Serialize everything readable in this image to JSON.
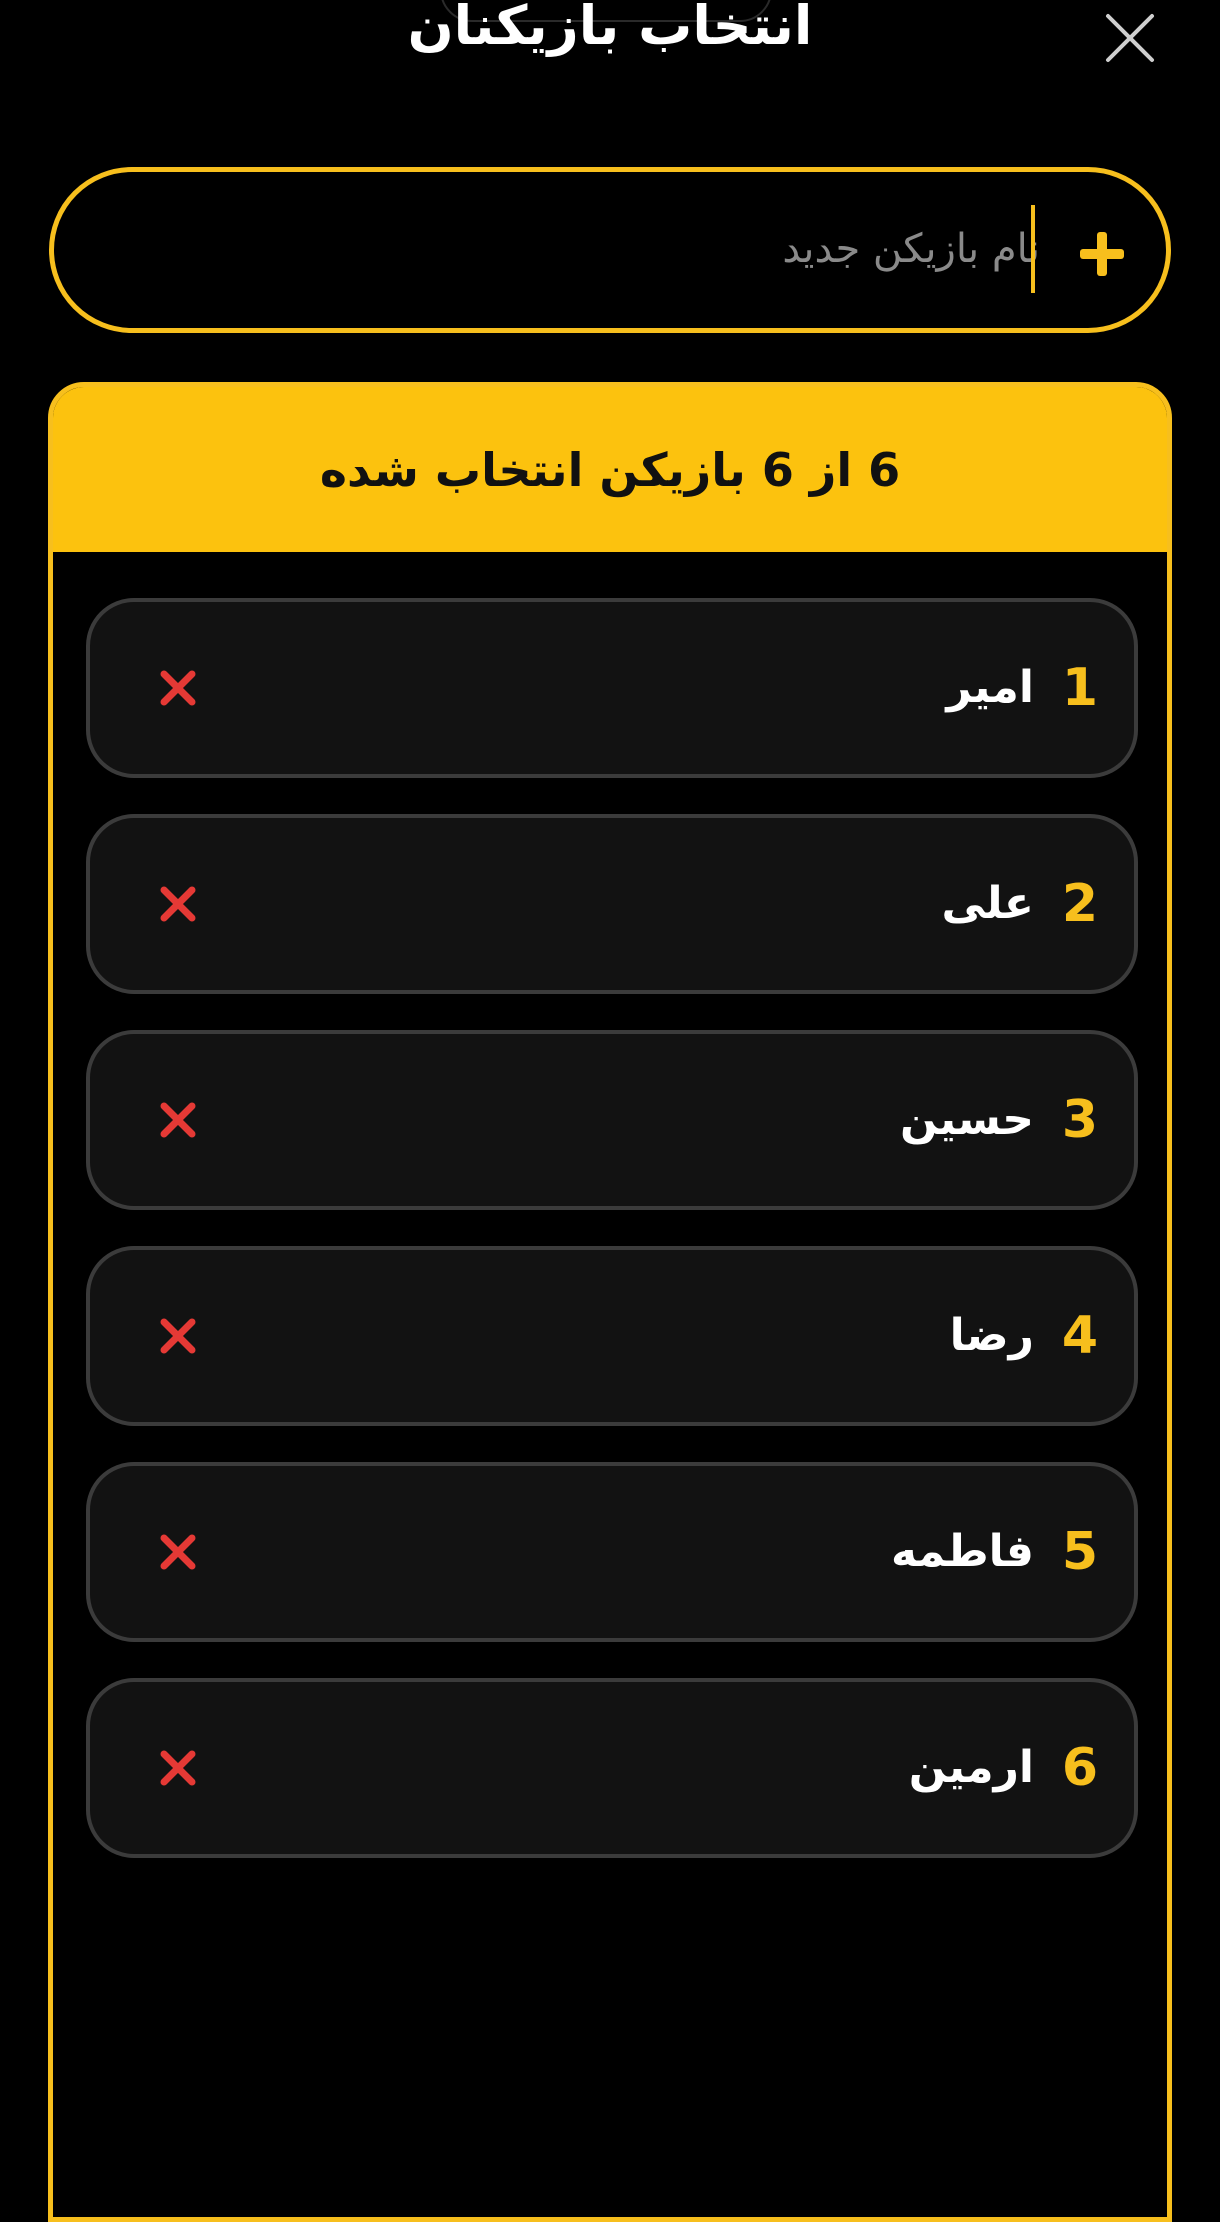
{
  "header": {
    "title": "انتخاب بازیکنان"
  },
  "add_player": {
    "placeholder": "نام بازیکن جدید",
    "value": ""
  },
  "panel": {
    "header_text": "6 از 6 بازیکن انتخاب شده"
  },
  "players": [
    {
      "number": "1",
      "name": "امیر"
    },
    {
      "number": "2",
      "name": "علی"
    },
    {
      "number": "3",
      "name": "حسین"
    },
    {
      "number": "4",
      "name": "رضا"
    },
    {
      "number": "5",
      "name": "فاطمه"
    },
    {
      "number": "6",
      "name": "ارمین"
    }
  ],
  "icons": {
    "close": "close-icon",
    "add": "plus-icon",
    "remove": "x-icon"
  },
  "colors": {
    "accent": "#fcc20e",
    "remove": "#e53935",
    "background": "#000000",
    "row_background": "#121212"
  }
}
